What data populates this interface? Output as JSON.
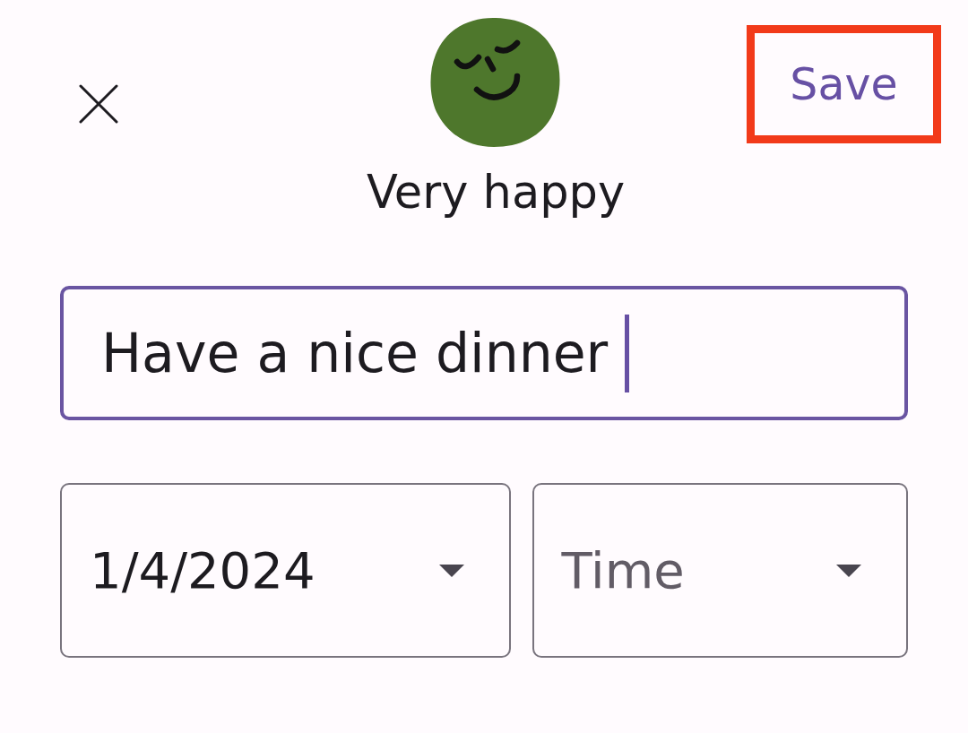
{
  "toolbar": {
    "save_button": {
      "label": "Save",
      "highlighted": true
    }
  },
  "mood": {
    "label": "Very happy"
  },
  "note_field": {
    "value": "Have a nice dinner",
    "focused": true
  },
  "date_dropdown": {
    "value": "1/4/2024"
  },
  "time_dropdown": {
    "placeholder": "Time"
  }
}
